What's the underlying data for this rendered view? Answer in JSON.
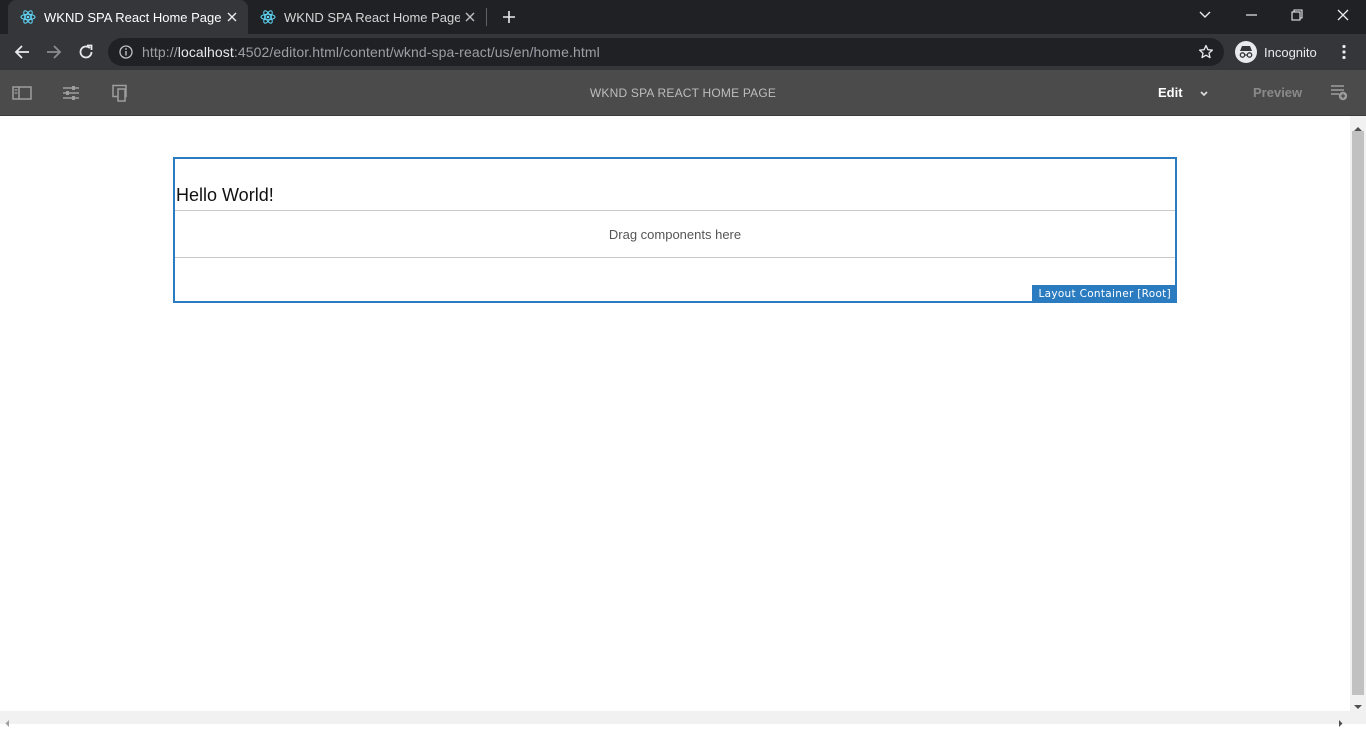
{
  "browser": {
    "tabs": [
      {
        "title": "WKND SPA React Home Page",
        "active": true
      },
      {
        "title": "WKND SPA React Home Page",
        "active": false
      }
    ],
    "url": {
      "scheme": "http://",
      "host": "localhost",
      "rest": ":4502/editor.html/content/wknd-spa-react/us/en/home.html"
    },
    "profile_label": "Incognito"
  },
  "editor": {
    "page_title": "WKND SPA REACT HOME PAGE",
    "mode_label": "Edit",
    "preview_label": "Preview"
  },
  "content": {
    "heading": "Hello World!",
    "dropzone_text": "Drag components here",
    "container_label": "Layout Container [Root]"
  },
  "colors": {
    "selection": "#2b7bc0",
    "editor_bar": "#4b4b4b"
  }
}
